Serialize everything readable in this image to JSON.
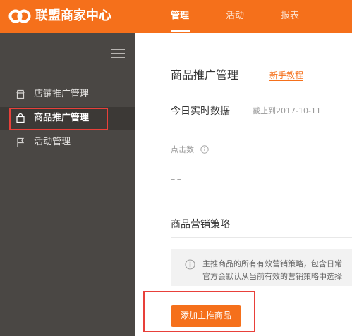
{
  "header": {
    "brand": "联盟商家中心",
    "nav": [
      {
        "label": "管理",
        "active": true
      },
      {
        "label": "活动",
        "active": false
      },
      {
        "label": "报表",
        "active": false
      }
    ],
    "accent_color": "#f5701b"
  },
  "sidebar": {
    "items": [
      {
        "label": "店铺推广管理",
        "icon": "store-icon",
        "active": false
      },
      {
        "label": "商品推广管理",
        "icon": "shopping-bag-icon",
        "active": true
      },
      {
        "label": "活动管理",
        "icon": "flag-icon",
        "active": false
      }
    ],
    "highlight_color": "#e8403a"
  },
  "main": {
    "title": "商品推广管理",
    "tutorial_link": "新手教程",
    "realtime": {
      "title": "今日实时数据",
      "date_note": "截止到2017-10-11",
      "metric_label": "点击数",
      "metric_value": "--"
    },
    "strategy": {
      "title": "商品营销策略",
      "notice_line1": "主推商品的所有有效营销策略，包含日常",
      "notice_line2": "官方会默认从当前有效的营销策略中选择"
    },
    "add_button": "添加主推商品"
  }
}
